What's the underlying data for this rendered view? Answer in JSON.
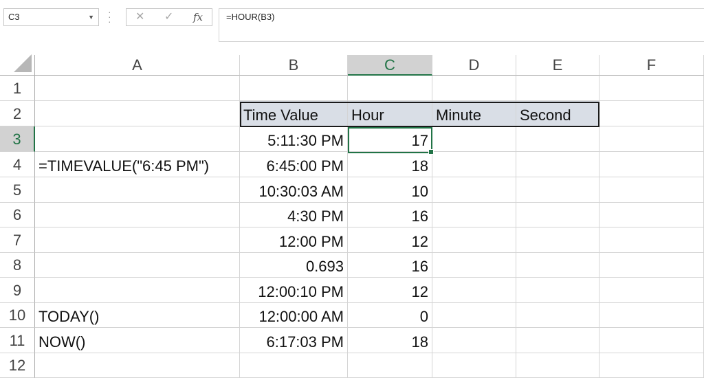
{
  "name_box": "C3",
  "formula": "=HOUR(B3)",
  "columns": [
    "A",
    "B",
    "C",
    "D",
    "E",
    "F"
  ],
  "rows": [
    "1",
    "2",
    "3",
    "4",
    "5",
    "6",
    "7",
    "8",
    "9",
    "10",
    "11",
    "12"
  ],
  "cells": {
    "B2": "Time Value",
    "C2": "Hour",
    "D2": "Minute",
    "E2": "Second",
    "B3": "5:11:30 PM",
    "C3": "17",
    "A4": "=TIMEVALUE(\"6:45 PM\")",
    "B4": "6:45:00 PM",
    "C4": "18",
    "B5": "10:30:03 AM",
    "C5": "10",
    "B6": "4:30 PM",
    "C6": "16",
    "B7": "12:00 PM",
    "C7": "12",
    "B8": "0.693",
    "C8": "16",
    "B9": "12:00:10 PM",
    "C9": "12",
    "A10": "TODAY()",
    "B10": "12:00:00 AM",
    "C10": "0",
    "A11": "NOW()",
    "B11": "6:17:03 PM",
    "C11": "18"
  },
  "selected_cell": "C3",
  "colors": {
    "accent": "#217346",
    "header_fill": "#d9dee6"
  }
}
